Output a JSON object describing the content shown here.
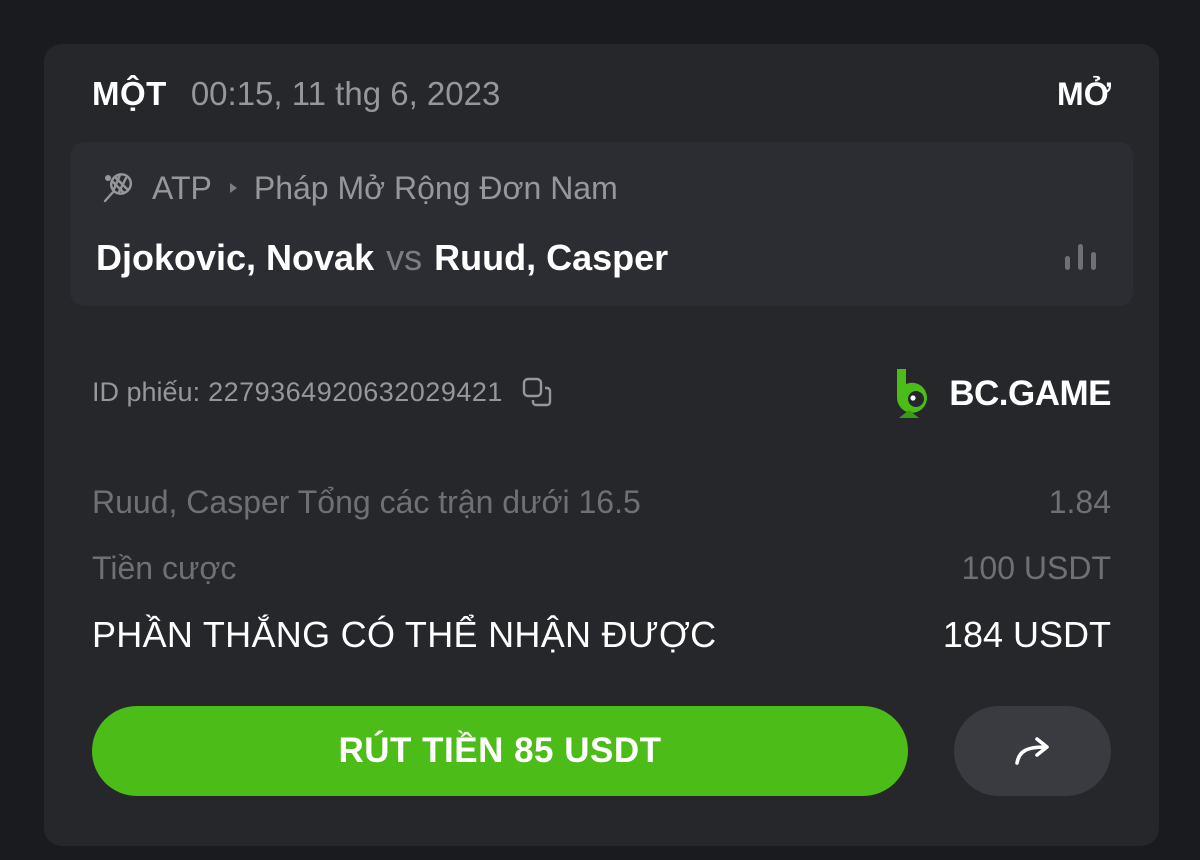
{
  "header": {
    "bet_type": "MỘT",
    "datetime": "00:15, 11 thg 6, 2023",
    "status": "MỞ"
  },
  "match": {
    "sport_icon": "tennis-racket-icon",
    "league": "ATP",
    "event": "Pháp Mở Rộng Đơn Nam",
    "team_home": "Djokovic, Novak",
    "vs": "vs",
    "team_away": "Ruud, Casper",
    "stats_icon": "bar-chart-icon"
  },
  "ticket": {
    "label": "ID phiếu:",
    "id": "227936492063202942​1",
    "copy_icon": "copy-icon"
  },
  "brand": {
    "name": "BC.GAME",
    "color": "#4cbc19"
  },
  "selection": {
    "label": "Ruud, Casper Tổng các trận dưới 16.5",
    "odds": "1.84"
  },
  "stake": {
    "label": "Tiền cược",
    "value": "100 USDT"
  },
  "potential_win": {
    "label": "PHẦN THẮNG CÓ THỂ NHẬN ĐƯỢC",
    "value": "184 USDT"
  },
  "actions": {
    "cashout_label": "RÚT TIỀN 85 USDT",
    "cashout_color": "#4cbc19",
    "share_icon": "share-arrow-icon"
  }
}
